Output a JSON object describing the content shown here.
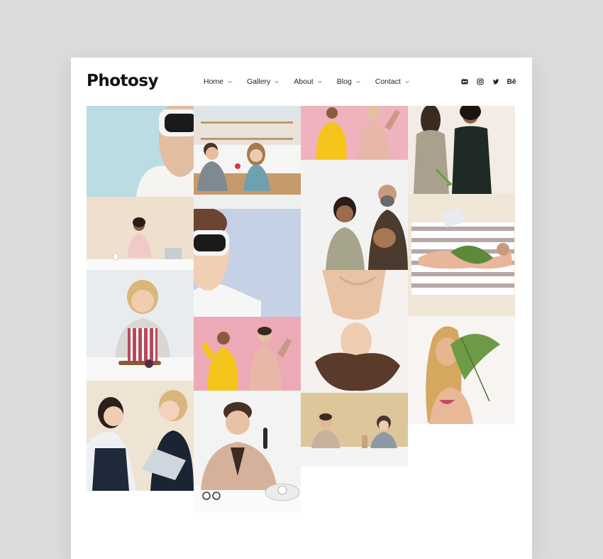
{
  "brand": {
    "logo": "Photosy"
  },
  "nav": [
    {
      "label": "Home"
    },
    {
      "label": "Gallery"
    },
    {
      "label": "About"
    },
    {
      "label": "Blog"
    },
    {
      "label": "Contact"
    }
  ],
  "social": [
    {
      "icon": "flickr-icon"
    },
    {
      "icon": "instagram-icon"
    },
    {
      "icon": "twitter-icon"
    },
    {
      "icon": "behance-icon",
      "label": "Bē"
    }
  ],
  "gallery": [
    {
      "alt": "Person wearing ski goggles on light blue background",
      "bg": "#b9dde3"
    },
    {
      "alt": "Couple sharing fruit in a white kitchen",
      "bg": "#e9e3da"
    },
    {
      "alt": "Two people in yellow and pink on pink background",
      "bg": "#efb3bd"
    },
    {
      "alt": "Two women posing in coat and black dress",
      "bg": "#f3ece4"
    },
    {
      "alt": "Woman with laptop and coffee cup",
      "bg": "#eedfcf"
    },
    {
      "alt": "Man with goggles on pale blue background",
      "bg": "#c5d1e4"
    },
    {
      "alt": "Woman laughing and man holding a dog",
      "bg": "#f2f2f2"
    },
    {
      "alt": "Woman lying on striped beach towel",
      "bg": "#f0e6d6"
    },
    {
      "alt": "Woman in striped apron cutting fruit",
      "bg": "#e9ecef"
    },
    {
      "alt": "Woman with long hair upside down",
      "bg": "#f4f1ee"
    },
    {
      "alt": "Two women with a folder",
      "bg": "#efe3d3"
    },
    {
      "alt": "Two friends in yellow and pink",
      "bg": "#ecaab6"
    },
    {
      "alt": "Woman holding palm leaf",
      "bg": "#f7f4f2"
    },
    {
      "alt": "Man on telephone at desk",
      "bg": "#f3f3f3"
    },
    {
      "alt": "Two people at a beige desk",
      "bg": "#dcc69a"
    }
  ]
}
